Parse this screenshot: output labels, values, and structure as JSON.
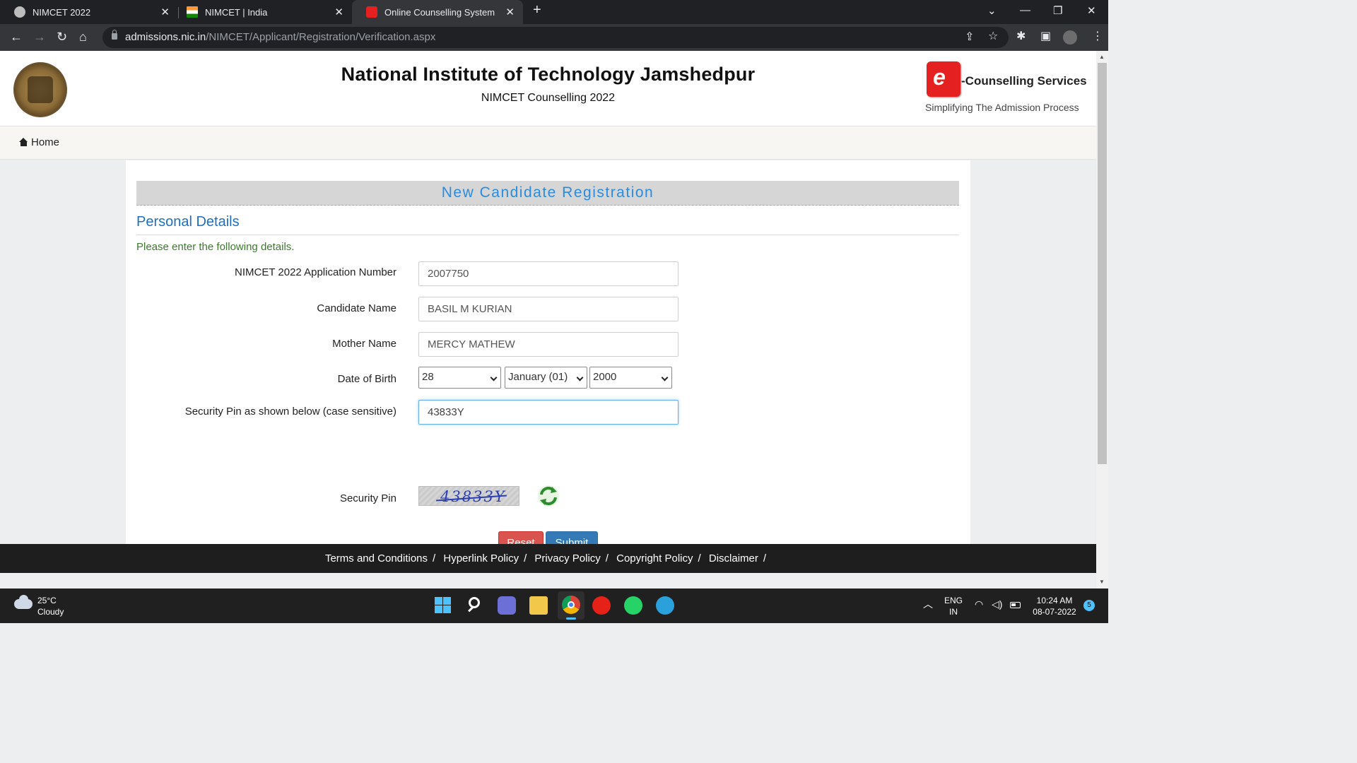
{
  "browser": {
    "tabs": [
      {
        "title": "NIMCET 2022",
        "active": false
      },
      {
        "title": "NIMCET | India",
        "active": false
      },
      {
        "title": "Online Counselling System",
        "active": true
      }
    ],
    "url_host": "admissions.nic.in",
    "url_path": "/NIMCET/Applicant/Registration/Verification.aspx"
  },
  "header": {
    "institute": "National Institute of Technology Jamshedpur",
    "subtitle": "NIMCET Counselling 2022",
    "brand_letter": "e",
    "brand_name": "-Counselling Services",
    "brand_tagline": "Simplifying The Admission Process"
  },
  "nav": {
    "home": "Home"
  },
  "form": {
    "title": "New Candidate Registration",
    "section": "Personal Details",
    "hint": "Please enter the following details.",
    "app_no_label": "NIMCET 2022 Application Number",
    "app_no_value": "2007750",
    "name_label": "Candidate Name",
    "name_value": "BASIL M KURIAN",
    "mother_label": "Mother Name",
    "mother_value": "MERCY MATHEW",
    "dob_label": "Date of Birth",
    "dob_day": "28",
    "dob_month": "January (01)",
    "dob_year": "2000",
    "pin_input_label": "Security Pin as shown below (case sensitive)",
    "pin_input_value": "43833Y",
    "pin_label": "Security Pin",
    "captcha_text": "43833Y",
    "reset": "Reset",
    "submit": "Submit"
  },
  "footer": {
    "links": [
      "Terms and Conditions",
      "Hyperlink Policy",
      "Privacy Policy",
      "Copyright Policy",
      "Disclaimer"
    ],
    "separator": "/"
  },
  "taskbar": {
    "temperature": "25°C",
    "weather": "Cloudy",
    "lang": "ENG",
    "region": "IN",
    "time": "10:24 AM",
    "date": "08-07-2022",
    "notifications": "5"
  },
  "colors": {
    "accent_blue": "#2a8be0",
    "section_blue": "#1f6fc1",
    "hint_green": "#3c7a2e",
    "reset_red": "#d9534f",
    "submit_blue": "#337ab7"
  }
}
